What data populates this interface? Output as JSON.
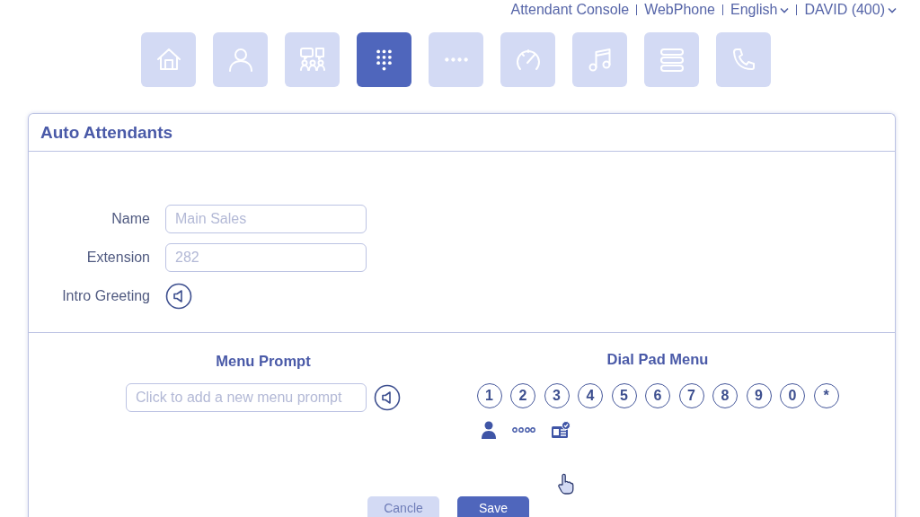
{
  "top_links": [
    {
      "label": "Attendant Console",
      "dropdown": false
    },
    {
      "label": "WebPhone",
      "dropdown": false
    },
    {
      "label": "English",
      "dropdown": true
    },
    {
      "label": "DAVID (400)",
      "dropdown": true
    }
  ],
  "nav_tabs": [
    {
      "kind": "home",
      "selected": false
    },
    {
      "kind": "user",
      "selected": false
    },
    {
      "kind": "conference",
      "selected": false
    },
    {
      "kind": "dialpad",
      "selected": true
    },
    {
      "kind": "dots",
      "selected": false
    },
    {
      "kind": "gauge",
      "selected": false
    },
    {
      "kind": "music",
      "selected": false
    },
    {
      "kind": "list",
      "selected": false
    },
    {
      "kind": "phone",
      "selected": false
    }
  ],
  "panel": {
    "title": "Auto Attendants",
    "fields": [
      {
        "label": "Name",
        "kind": "text",
        "placeholder": "Main Sales"
      },
      {
        "label": "Extension",
        "kind": "text",
        "placeholder": "282"
      },
      {
        "label": "Intro Greeting",
        "kind": "audio"
      }
    ],
    "menu_prompt": {
      "heading": "Menu Prompt",
      "placeholder": "Click to add a new menu prompt"
    },
    "dial_pad_menu": {
      "heading": "Dial Pad Menu",
      "keys": [
        "1",
        "2",
        "3",
        "4",
        "5",
        "6",
        "7",
        "8",
        "9",
        "0",
        "*"
      ]
    },
    "buttons": [
      {
        "label": "Cancle",
        "disabled": true
      },
      {
        "label": "Save",
        "disabled": false
      }
    ]
  }
}
